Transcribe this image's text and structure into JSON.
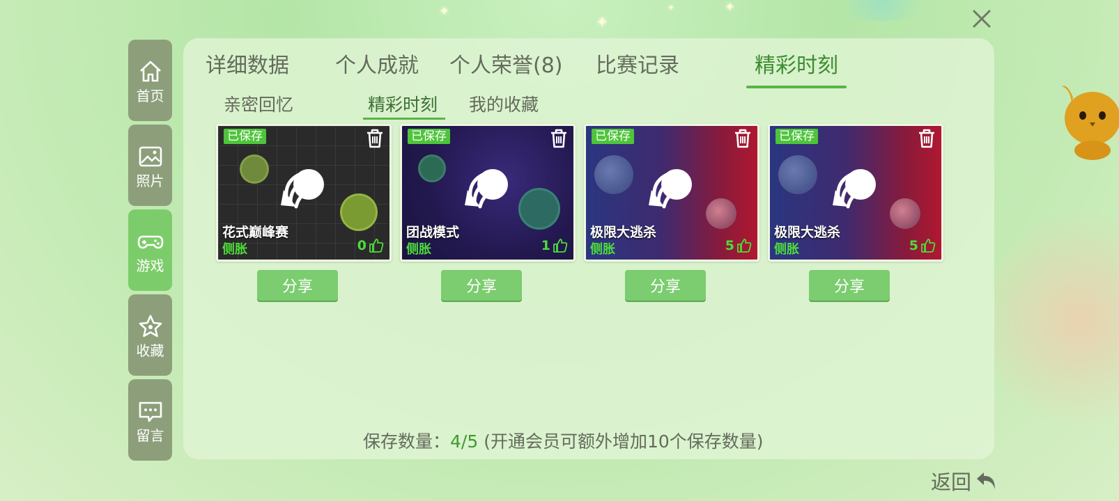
{
  "window": {
    "close_icon": "close-icon"
  },
  "sidebar": {
    "items": [
      {
        "label": "首页",
        "icon": "home-icon",
        "active": false
      },
      {
        "label": "照片",
        "icon": "image-icon",
        "active": false
      },
      {
        "label": "游戏",
        "icon": "gamepad-icon",
        "active": true
      },
      {
        "label": "收藏",
        "icon": "star-icon",
        "active": false
      },
      {
        "label": "留言",
        "icon": "message-icon",
        "active": false
      }
    ]
  },
  "tabs": [
    {
      "label": "详细数据"
    },
    {
      "label": "个人成就"
    },
    {
      "label": "个人荣誉(8)"
    },
    {
      "label": "比赛记录"
    },
    {
      "label": "精彩时刻",
      "active": true
    }
  ],
  "subtabs": [
    {
      "label": "亲密回忆"
    },
    {
      "label": "精彩时刻",
      "active": true
    },
    {
      "label": "我的收藏"
    }
  ],
  "cards": [
    {
      "badge": "已保存",
      "title": "花式巅峰赛",
      "subtitle": "侧胀",
      "likes": "0",
      "share_label": "分享",
      "theme": "dark-grid"
    },
    {
      "badge": "已保存",
      "title": "团战模式",
      "subtitle": "侧胀",
      "likes": "1",
      "share_label": "分享",
      "theme": "purple-space"
    },
    {
      "badge": "已保存",
      "title": "极限大逃杀",
      "subtitle": "侧胀",
      "likes": "5",
      "share_label": "分享",
      "theme": "blue-red"
    },
    {
      "badge": "已保存",
      "title": "极限大逃杀",
      "subtitle": "侧胀",
      "likes": "5",
      "share_label": "分享",
      "theme": "blue-red"
    }
  ],
  "footer": {
    "prefix": "保存数量：",
    "count": "4/5",
    "suffix": " (开通会员可额外增加10个保存数量)"
  },
  "back": {
    "label": "返回"
  },
  "colors": {
    "accent": "#59b446",
    "sidebar_bg": "#8d9f7a",
    "sidebar_active": "#7dcc6b",
    "like_green": "#4edc3b"
  }
}
